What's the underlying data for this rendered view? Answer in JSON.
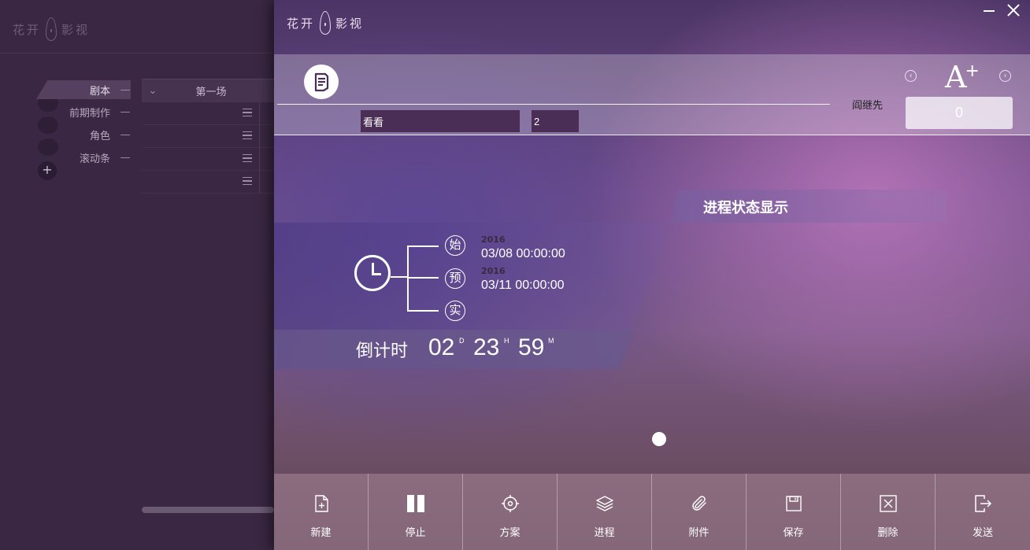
{
  "background_app": {
    "logo_text_left": "花开",
    "logo_text_right": "影视",
    "sidebar": {
      "items": [
        {
          "label": "剧本",
          "dash": "—"
        },
        {
          "label": "前期制作",
          "dash": "—"
        },
        {
          "label": "角色",
          "dash": "—"
        },
        {
          "label": "滚动条",
          "dash": "—"
        }
      ],
      "add_label": "+"
    },
    "table": {
      "header": "第一场"
    }
  },
  "dialog": {
    "logo_text_left": "花开",
    "logo_text_right": "影视",
    "window_controls": {
      "minimize_icon": "minimize-icon",
      "close_icon": "close-icon"
    },
    "header": {
      "name_value": "看看",
      "number_value": "2",
      "reader_label": "阎继先",
      "font_size_glyph": "A",
      "font_size_plus": "+",
      "count_value": "0",
      "arrow_left": "‹",
      "arrow_right": "›"
    },
    "status_title": "进程状态显示",
    "timeline": {
      "badges": [
        "始",
        "预",
        "实"
      ],
      "start": {
        "year": "2016",
        "date": "03/08 00:00:00"
      },
      "planned": {
        "year": "2016",
        "date": "03/11 00:00:00"
      }
    },
    "countdown": {
      "label": "倒计时",
      "days": "02",
      "days_unit": "D",
      "hours": "23",
      "hours_unit": "H",
      "minutes": "59",
      "minutes_unit": "M"
    },
    "toolbar": {
      "buttons": [
        {
          "label": "新建",
          "icon": "new-file-icon"
        },
        {
          "label": "停止",
          "icon": "pause-icon"
        },
        {
          "label": "方案",
          "icon": "target-icon"
        },
        {
          "label": "进程",
          "icon": "layers-icon"
        },
        {
          "label": "附件",
          "icon": "paperclip-icon"
        },
        {
          "label": "保存",
          "icon": "save-icon"
        },
        {
          "label": "删除",
          "icon": "delete-icon"
        },
        {
          "label": "发送",
          "icon": "send-icon"
        }
      ]
    }
  }
}
